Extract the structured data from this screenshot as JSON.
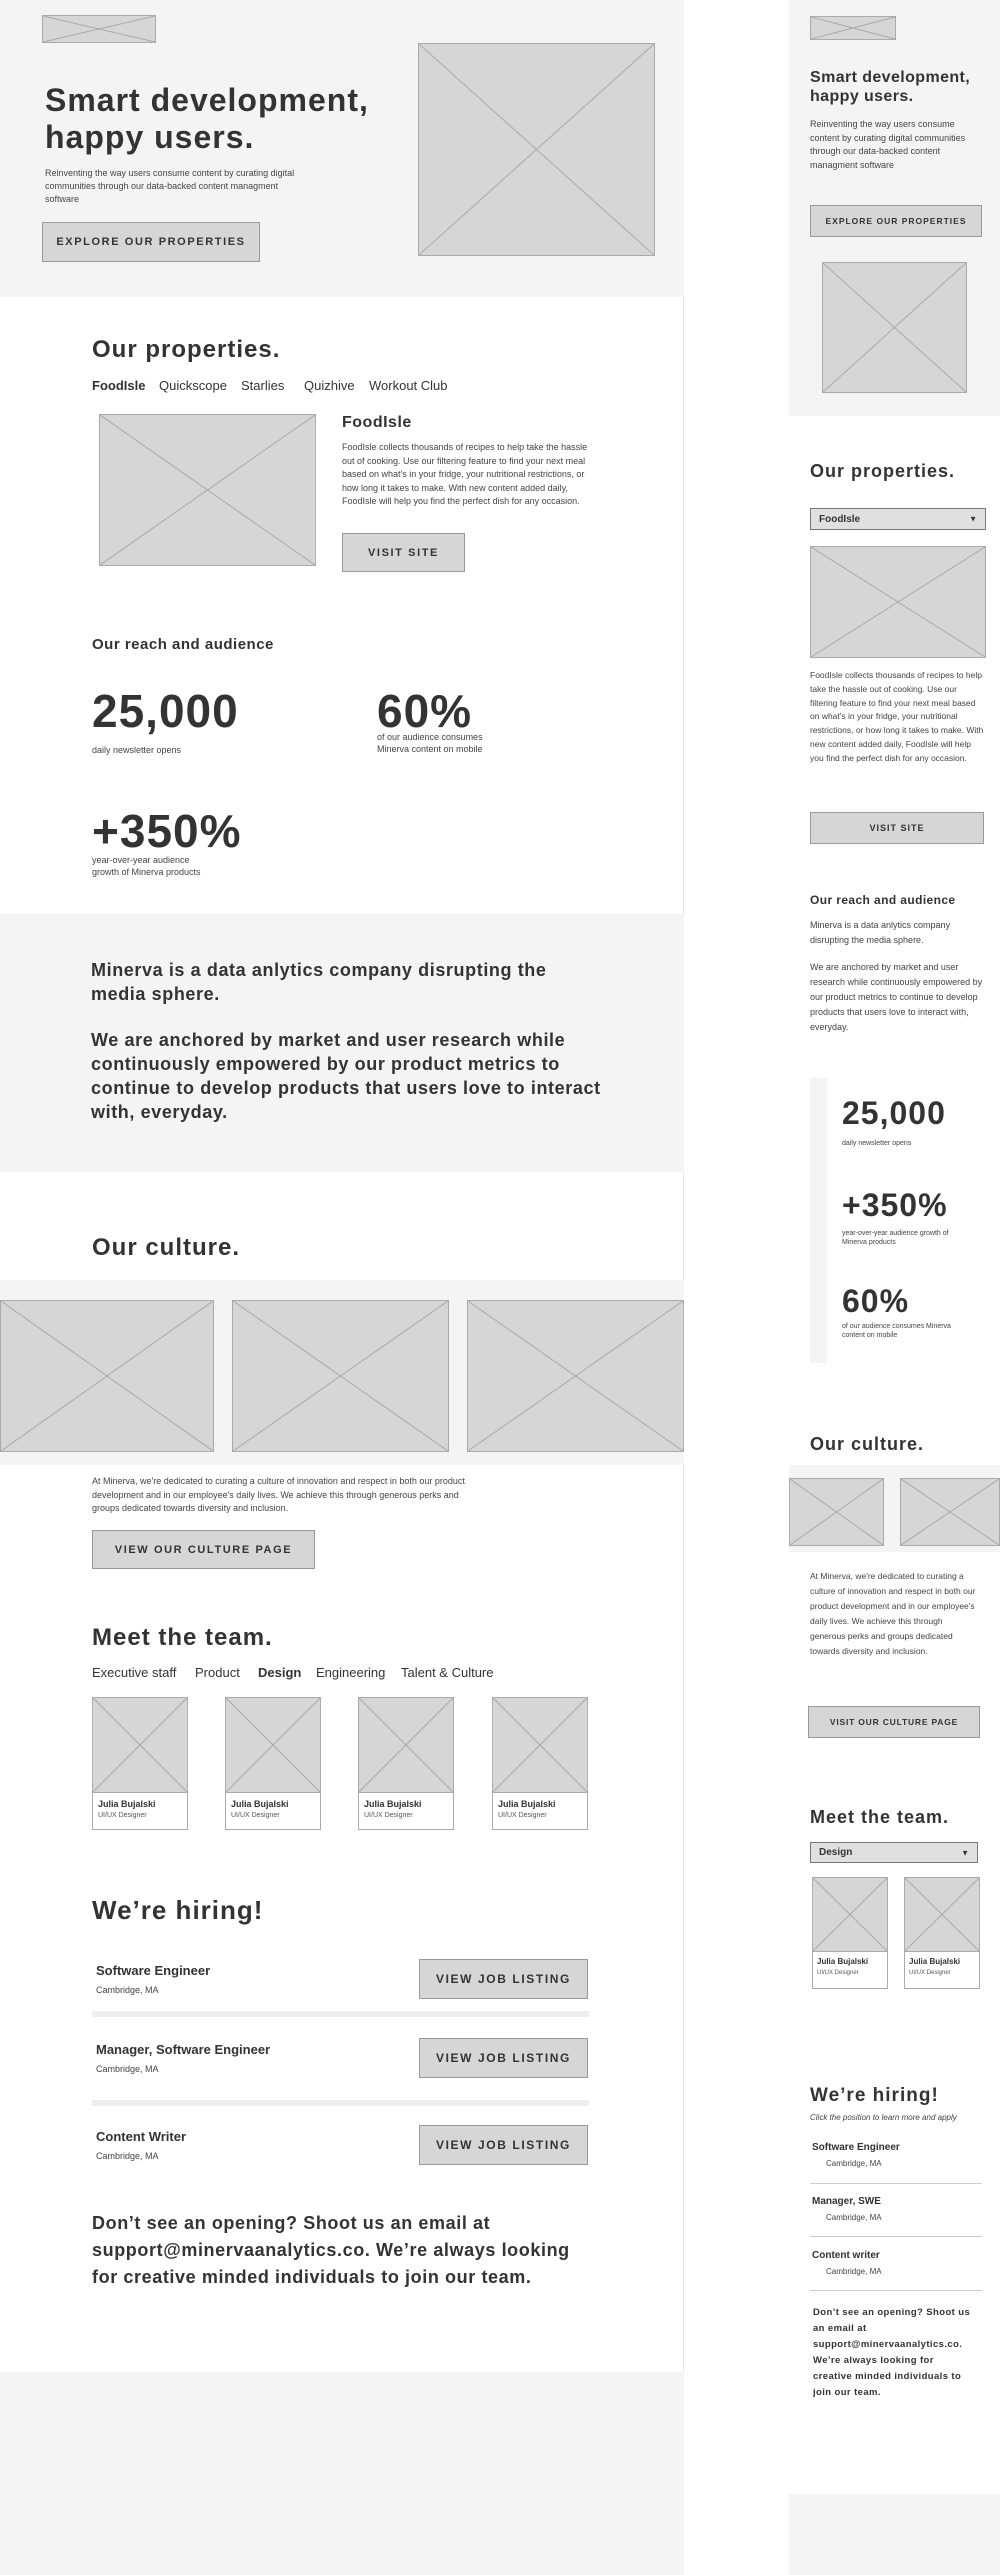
{
  "desktop": {
    "hero": {
      "title_line1": "Smart development,",
      "title_line2": "happy users.",
      "description": "Reinventing the way users consume content by curating digital communities through our data-backed content managment software",
      "cta": "EXPLORE OUR PROPERTIES"
    },
    "properties": {
      "title": "Our properties.",
      "tabs": [
        "FoodIsle",
        "Quickscope",
        "Starlies",
        "Quizhive",
        "Workout Club"
      ],
      "active_tab": "FoodIsle",
      "detail_title": "FoodIsle",
      "detail_text": "FoodIsle collects thousands of recipes to help take the hassle out of cooking. Use our filtering feature to find your next meal based on what's in your fridge, your nutritional restrictions, or how long it takes to make. With new content added daily, FoodIsle will help you find the perfect dish for any occasion.",
      "visit_button": "VISIT SITE"
    },
    "reach": {
      "title": "Our reach and audience",
      "stats": [
        {
          "value": "25,000",
          "label": "daily newsletter opens"
        },
        {
          "value": "60%",
          "label": "of our audience consumes Minerva content on mobile"
        },
        {
          "value": "+350%",
          "label": "year-over-year audience growth of Minerva products"
        }
      ]
    },
    "mission": {
      "line1": "Minerva is a data anlytics company disrupting the media sphere.",
      "line2": "We are anchored by market and user research while continuously empowered by our product metrics to continue to develop products that users love to interact with, everyday."
    },
    "culture": {
      "title": "Our culture.",
      "text": "At Minerva, we're dedicated to curating a culture of innovation and respect in both our product development and in our employee's daily lives. We achieve this through generous perks and groups dedicated towards diversity and inclusion.",
      "button": "VIEW OUR CULTURE PAGE"
    },
    "team": {
      "title": "Meet the team.",
      "tabs": [
        "Executive staff",
        "Product",
        "Design",
        "Engineering",
        "Talent & Culture"
      ],
      "active_tab": "Design",
      "members": [
        {
          "name": "Julia Bujalski",
          "role": "UI/UX Designer"
        },
        {
          "name": "Julia Bujalski",
          "role": "UI/UX Designer"
        },
        {
          "name": "Julia Bujalski",
          "role": "UI/UX Designer"
        },
        {
          "name": "Julia Bujalski",
          "role": "UI/UX Designer"
        }
      ]
    },
    "hiring": {
      "title": "We’re hiring!",
      "jobs": [
        {
          "title": "Software Engineer",
          "location": "Cambridge, MA",
          "button": "VIEW JOB LISTING"
        },
        {
          "title": "Manager, Software Engineer",
          "location": "Cambridge, MA",
          "button": "VIEW JOB LISTING"
        },
        {
          "title": "Content Writer",
          "location": "Cambridge, MA",
          "button": "VIEW JOB LISTING"
        }
      ],
      "footer_line1": "Don’t see an opening? Shoot us an email at",
      "footer_line2": "support@minervaanalytics.co. We’re always looking",
      "footer_line3": "for creative minded individuals to join our team."
    }
  },
  "mobile": {
    "hero": {
      "title_line1": "Smart development,",
      "title_line2": "happy users.",
      "description": "Reinventing the way users consume content by curating digital communities through our data-backed content managment software",
      "cta": "EXPLORE OUR PROPERTIES"
    },
    "properties": {
      "title": "Our properties.",
      "select_value": "FoodIsle",
      "detail_text": "FoodIsle collects thousands of recipes to help take the hassle out of cooking. Use our filtering feature to find your next meal based on what's in your fridge, your nutritional restrictions, or how long it takes to make. With new content added daily, FoodIsle will help you find the perfect dish for any occasion.",
      "visit_button": "VISIT SITE"
    },
    "reach": {
      "title": "Our reach and audience",
      "intro1": "Minerva is a data anlytics company disrupting the media sphere.",
      "intro2": "We are anchored by market and user research while continuously empowered by our product metrics to continue to develop products that users love to interact with, everyday.",
      "stats": [
        {
          "value": "25,000",
          "label": "daily newsletter opens"
        },
        {
          "value": "+350%",
          "label": "year-over-year audience growth of Minerva products"
        },
        {
          "value": "60%",
          "label": "of our audience consumes Minerva content on mobile"
        }
      ]
    },
    "culture": {
      "title": "Our culture.",
      "text": "At Minerva, we're dedicated to curating a culture of innovation and respect in both our product development and in our employee's daily lives. We achieve this through generous perks and groups dedicated towards diversity and inclusion.",
      "button": "VISIT OUR CULTURE PAGE"
    },
    "team": {
      "title": "Meet the team.",
      "select_value": "Design",
      "members": [
        {
          "name": "Julia Bujalski",
          "role": "UI/UX Designer"
        },
        {
          "name": "Julia Bujalski",
          "role": "UI/UX Designer"
        }
      ]
    },
    "hiring": {
      "title": "We’re hiring!",
      "subtitle": "Click the position to learn more and apply",
      "jobs": [
        {
          "title": "Software Engineer",
          "location": "Cambridge, MA"
        },
        {
          "title": "Manager, SWE",
          "location": "Cambridge, MA"
        },
        {
          "title": "Content writer",
          "location": "Cambridge, MA"
        }
      ],
      "footer": "Don’t see an opening? Shoot us an email at support@minervaanalytics.co. We’re always looking for creative minded individuals to join our team."
    }
  }
}
